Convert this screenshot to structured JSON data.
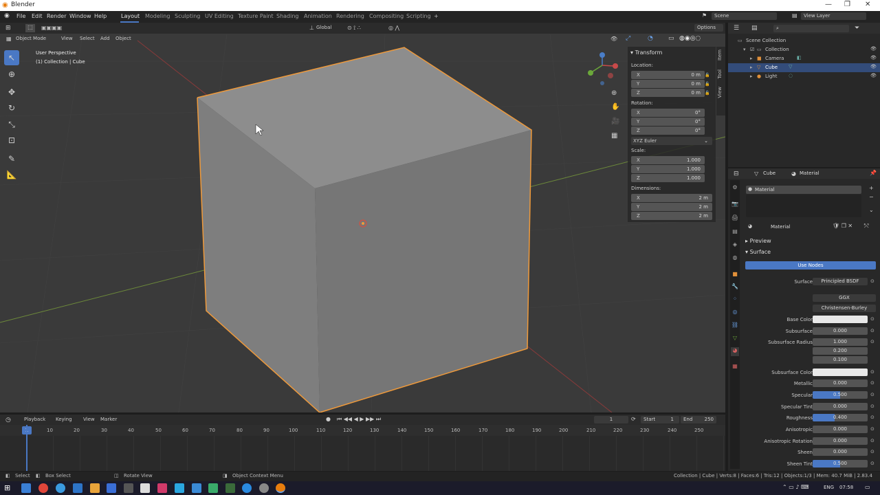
{
  "app": {
    "title": "Blender",
    "menus": [
      "File",
      "Edit",
      "Render",
      "Window",
      "Help"
    ],
    "workspaces": [
      "Layout",
      "Modeling",
      "Sculpting",
      "UV Editing",
      "Texture Paint",
      "Shading",
      "Animation",
      "Rendering",
      "Compositing",
      "Scripting"
    ],
    "add_tab": "+",
    "scene": "Scene",
    "view_layer": "View Layer"
  },
  "viewport": {
    "mode": "Object Mode",
    "menus": [
      "View",
      "Select",
      "Add",
      "Object"
    ],
    "orientation": "Global",
    "options": "Options",
    "perspective": "User Perspective",
    "context": "(1) Collection | Cube",
    "accent": "#f09a3a"
  },
  "transform": {
    "title": "Transform",
    "location_label": "Location:",
    "location": [
      {
        "axis": "X",
        "value": "0 m"
      },
      {
        "axis": "Y",
        "value": "0 m"
      },
      {
        "axis": "Z",
        "value": "0 m"
      }
    ],
    "rotation_label": "Rotation:",
    "rotation": [
      {
        "axis": "X",
        "value": "0°"
      },
      {
        "axis": "Y",
        "value": "0°"
      },
      {
        "axis": "Z",
        "value": "0°"
      }
    ],
    "rotation_mode": "XYZ Euler",
    "scale_label": "Scale:",
    "scale": [
      {
        "axis": "X",
        "value": "1.000"
      },
      {
        "axis": "Y",
        "value": "1.000"
      },
      {
        "axis": "Z",
        "value": "1.000"
      }
    ],
    "dimensions_label": "Dimensions:",
    "dimensions": [
      {
        "axis": "X",
        "value": "2 m"
      },
      {
        "axis": "Y",
        "value": "2 m"
      },
      {
        "axis": "Z",
        "value": "2 m"
      }
    ]
  },
  "sidetabs": [
    "Item",
    "Tool",
    "View"
  ],
  "outliner": {
    "items": [
      {
        "label": "Scene Collection",
        "indent": 0
      },
      {
        "label": "Collection",
        "indent": 1
      },
      {
        "label": "Camera",
        "indent": 2
      },
      {
        "label": "Cube",
        "indent": 2,
        "selected": true
      },
      {
        "label": "Light",
        "indent": 2
      }
    ]
  },
  "properties": {
    "object": "Cube",
    "material_tab": "Material",
    "slot": "Material",
    "material_name": "Material",
    "preview": "Preview",
    "surface_section": "Surface",
    "use_nodes": "Use Nodes",
    "rows": [
      {
        "label": "Surface",
        "value": "Principled BSDF"
      },
      {
        "label": "",
        "value": "GGX"
      },
      {
        "label": "",
        "value": "Christensen-Burley"
      },
      {
        "label": "Base Color",
        "value": "",
        "type": "white"
      },
      {
        "label": "Subsurface",
        "value": "0.000"
      },
      {
        "label": "Subsurface Radius",
        "value": "1.000"
      },
      {
        "label": "",
        "value": "0.200"
      },
      {
        "label": "",
        "value": "0.100"
      },
      {
        "label": "Subsurface Color",
        "value": "",
        "type": "white"
      },
      {
        "label": "Metallic",
        "value": "0.000"
      },
      {
        "label": "Specular",
        "value": "0.500",
        "type": "blue"
      },
      {
        "label": "Specular Tint",
        "value": "0.000"
      },
      {
        "label": "Roughness",
        "value": "0.400",
        "type": "blue"
      },
      {
        "label": "Anisotropic",
        "value": "0.000"
      },
      {
        "label": "Anisotropic Rotation",
        "value": "0.000"
      },
      {
        "label": "Sheen",
        "value": "0.000"
      },
      {
        "label": "Sheen Tint",
        "value": "0.500",
        "type": "blue"
      }
    ]
  },
  "timeline": {
    "menus": [
      "Playback",
      "Keying",
      "View",
      "Marker"
    ],
    "current_frame": "1",
    "start_label": "Start",
    "start": "1",
    "end_label": "End",
    "end": "250",
    "ticks": [
      "1",
      "10",
      "20",
      "30",
      "40",
      "50",
      "60",
      "70",
      "80",
      "90",
      "100",
      "110",
      "120",
      "130",
      "140",
      "150",
      "160",
      "170",
      "180",
      "190",
      "200",
      "210",
      "220",
      "230",
      "240",
      "250"
    ]
  },
  "status": {
    "select": "Select",
    "box_select": "Box Select",
    "rotate": "Rotate View",
    "context_menu": "Object Context Menu",
    "stats": "Collection | Cube | Verts:8 | Faces:6 | Tris:12 | Objects:1/3 | Mem: 40.7 MiB | 2.83.4"
  },
  "taskbar": {
    "lang": "ENG",
    "time": "07:58"
  }
}
